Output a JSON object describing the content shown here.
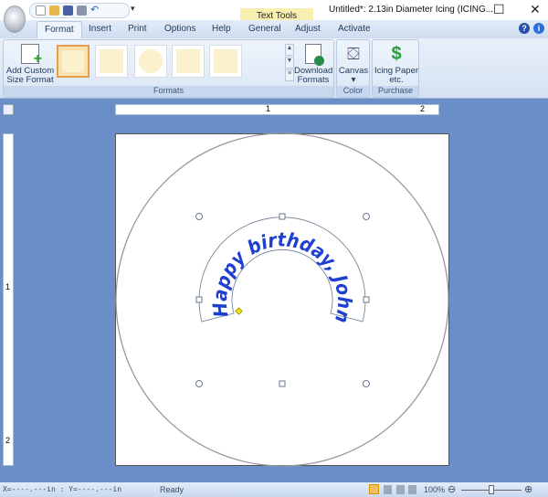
{
  "window": {
    "title": "Untitled*: 2.13in Diameter Icing (ICING...",
    "context_tab": "Text Tools",
    "minimize": "—",
    "maximize": "☐",
    "close": "✕"
  },
  "tabs": [
    "Format",
    "Insert",
    "Print",
    "Options",
    "Help",
    "General",
    "Adjust",
    "Activate"
  ],
  "ribbon": {
    "add_custom": "Add Custom Size Format",
    "download": "Download Formats",
    "canvas": "Canvas",
    "icing_paper": "Icing Paper etc.",
    "groups": {
      "formats": "Formats",
      "color": "Color",
      "purchase": "Purchase"
    }
  },
  "ruler": {
    "h_marks": [
      "1",
      "2"
    ],
    "v_marks": [
      "1",
      "2"
    ]
  },
  "design": {
    "text": "Happy birthday, John",
    "text_color": "#1f3fd0"
  },
  "status": {
    "coords": "X=----.---in : Y=----.---in",
    "state": "Ready",
    "zoom": "100%",
    "zoom_level": 0.5
  }
}
